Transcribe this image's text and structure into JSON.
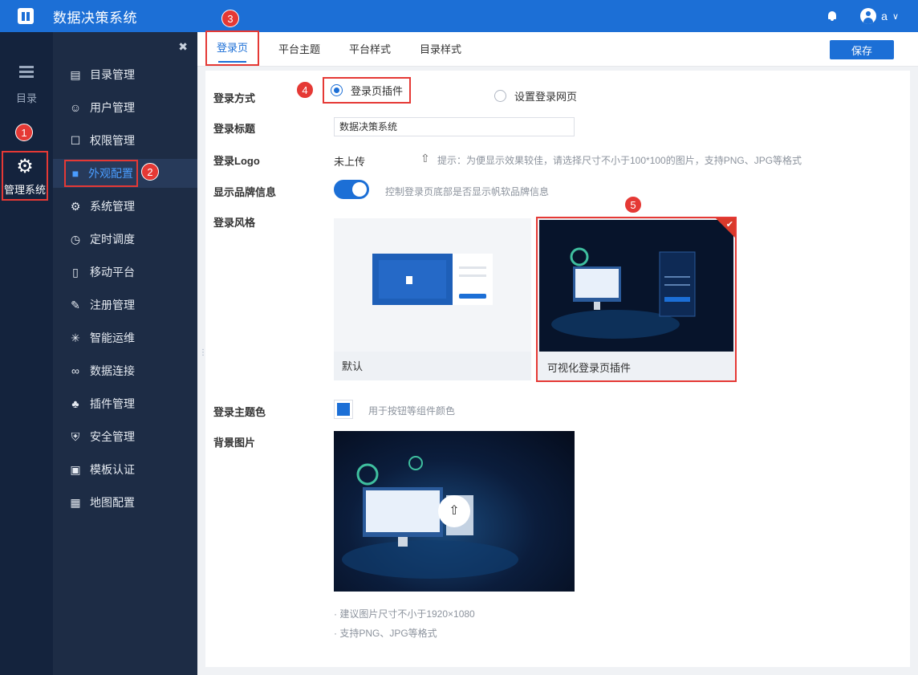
{
  "header": {
    "title": "数据决策系统",
    "user": "a"
  },
  "rail": {
    "catalog_label": "目录",
    "admin_label": "管理系统"
  },
  "menu": [
    {
      "label": "目录管理",
      "icon": "catalog-icon"
    },
    {
      "label": "用户管理",
      "icon": "user-icon"
    },
    {
      "label": "权限管理",
      "icon": "lock-icon"
    },
    {
      "label": "外观配置",
      "icon": "brush-icon"
    },
    {
      "label": "系统管理",
      "icon": "gear-icon"
    },
    {
      "label": "定时调度",
      "icon": "timer-icon"
    },
    {
      "label": "移动平台",
      "icon": "mobile-icon"
    },
    {
      "label": "注册管理",
      "icon": "register-icon"
    },
    {
      "label": "智能运维",
      "icon": "ops-icon"
    },
    {
      "label": "数据连接",
      "icon": "link-icon"
    },
    {
      "label": "插件管理",
      "icon": "plugin-icon"
    },
    {
      "label": "安全管理",
      "icon": "shield-icon"
    },
    {
      "label": "模板认证",
      "icon": "template-icon"
    },
    {
      "label": "地图配置",
      "icon": "map-icon"
    }
  ],
  "tabs": [
    "登录页",
    "平台主题",
    "平台样式",
    "目录样式"
  ],
  "save_label": "保存",
  "form": {
    "login_mode_label": "登录方式",
    "login_mode_options": [
      "登录页插件",
      "设置登录网页"
    ],
    "login_title_label": "登录标题",
    "login_title_value": "数据决策系统",
    "logo_label": "登录Logo",
    "logo_value": "未上传",
    "logo_hint": "提示：为便显示效果较佳，请选择尺寸不小于100*100的图片，支持PNG、JPG等格式",
    "brand_label": "显示品牌信息",
    "brand_hint": "控制登录页底部是否显示帆软品牌信息",
    "style_label": "登录风格",
    "style_options": [
      "默认",
      "可视化登录页插件"
    ],
    "theme_color_label": "登录主题色",
    "theme_color_hint": "用于按钮等组件颜色",
    "theme_color": "#1c6fd6",
    "bg_label": "背景图片",
    "bg_notes": [
      "· 建议图片尺寸不小于1920×1080",
      "· 支持PNG、JPG等格式"
    ]
  },
  "badges": [
    "1",
    "2",
    "3",
    "4",
    "5"
  ]
}
